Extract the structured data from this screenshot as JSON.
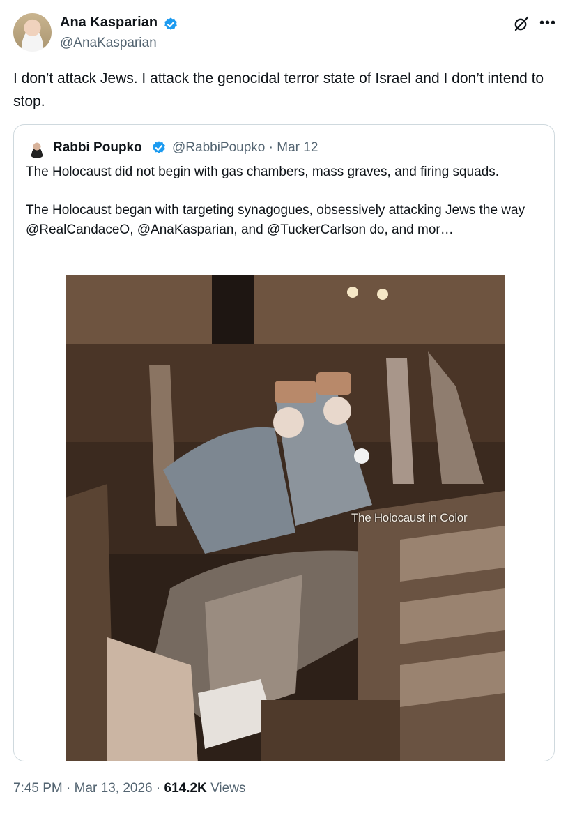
{
  "author": {
    "name": "Ana Kasparian",
    "handle": "@AnaKasparian"
  },
  "tweet": {
    "text": "I don’t attack Jews. I attack the genocidal terror state of Israel and I don’t intend to stop."
  },
  "quoted": {
    "name": "Rabbi Poupko",
    "handle": "@RabbiPoupko",
    "separator": "·",
    "date": "Mar 12",
    "paragraph1": "The Holocaust did not begin with gas chambers, mass graves, and firing squads.",
    "paragraph2": "The Holocaust began with targeting synagogues, obsessively attacking Jews the way @RealCandaceO, @AnaKasparian, and @TuckerCarlson do, and mor…",
    "image_watermark": "The Holocaust in Color"
  },
  "footer": {
    "time": "7:45 PM",
    "sep1": "·",
    "date": "Mar 13, 2026",
    "sep2": "·",
    "views_count": "614.2K",
    "views_label": "Views"
  },
  "colors": {
    "verified": "#1d9bf0",
    "secondary_text": "#536471",
    "border": "#cfd9de"
  },
  "icons": [
    "verified-badge-icon",
    "grok-icon",
    "more-icon"
  ]
}
